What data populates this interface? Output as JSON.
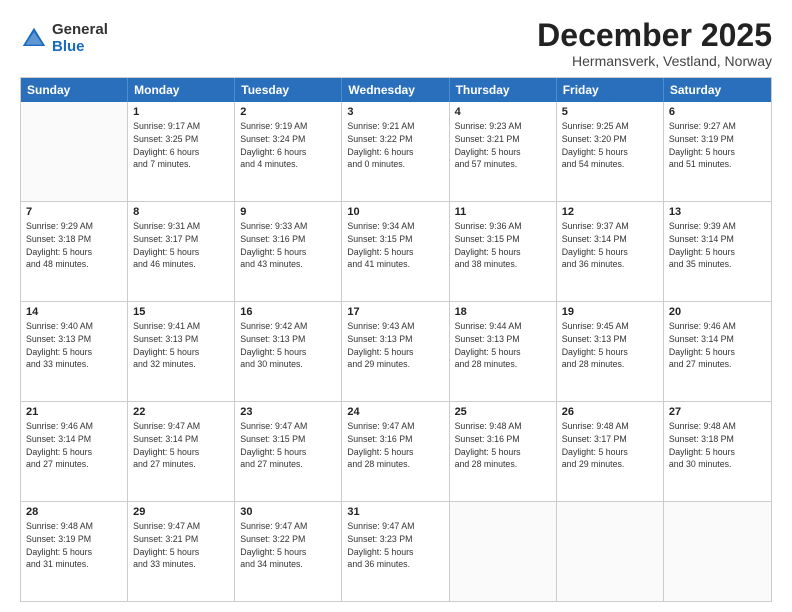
{
  "logo": {
    "general": "General",
    "blue": "Blue"
  },
  "title": "December 2025",
  "subtitle": "Hermansverk, Vestland, Norway",
  "days": [
    "Sunday",
    "Monday",
    "Tuesday",
    "Wednesday",
    "Thursday",
    "Friday",
    "Saturday"
  ],
  "weeks": [
    [
      {
        "day": "",
        "info": ""
      },
      {
        "day": "1",
        "info": "Sunrise: 9:17 AM\nSunset: 3:25 PM\nDaylight: 6 hours\nand 7 minutes."
      },
      {
        "day": "2",
        "info": "Sunrise: 9:19 AM\nSunset: 3:24 PM\nDaylight: 6 hours\nand 4 minutes."
      },
      {
        "day": "3",
        "info": "Sunrise: 9:21 AM\nSunset: 3:22 PM\nDaylight: 6 hours\nand 0 minutes."
      },
      {
        "day": "4",
        "info": "Sunrise: 9:23 AM\nSunset: 3:21 PM\nDaylight: 5 hours\nand 57 minutes."
      },
      {
        "day": "5",
        "info": "Sunrise: 9:25 AM\nSunset: 3:20 PM\nDaylight: 5 hours\nand 54 minutes."
      },
      {
        "day": "6",
        "info": "Sunrise: 9:27 AM\nSunset: 3:19 PM\nDaylight: 5 hours\nand 51 minutes."
      }
    ],
    [
      {
        "day": "7",
        "info": "Sunrise: 9:29 AM\nSunset: 3:18 PM\nDaylight: 5 hours\nand 48 minutes."
      },
      {
        "day": "8",
        "info": "Sunrise: 9:31 AM\nSunset: 3:17 PM\nDaylight: 5 hours\nand 46 minutes."
      },
      {
        "day": "9",
        "info": "Sunrise: 9:33 AM\nSunset: 3:16 PM\nDaylight: 5 hours\nand 43 minutes."
      },
      {
        "day": "10",
        "info": "Sunrise: 9:34 AM\nSunset: 3:15 PM\nDaylight: 5 hours\nand 41 minutes."
      },
      {
        "day": "11",
        "info": "Sunrise: 9:36 AM\nSunset: 3:15 PM\nDaylight: 5 hours\nand 38 minutes."
      },
      {
        "day": "12",
        "info": "Sunrise: 9:37 AM\nSunset: 3:14 PM\nDaylight: 5 hours\nand 36 minutes."
      },
      {
        "day": "13",
        "info": "Sunrise: 9:39 AM\nSunset: 3:14 PM\nDaylight: 5 hours\nand 35 minutes."
      }
    ],
    [
      {
        "day": "14",
        "info": "Sunrise: 9:40 AM\nSunset: 3:13 PM\nDaylight: 5 hours\nand 33 minutes."
      },
      {
        "day": "15",
        "info": "Sunrise: 9:41 AM\nSunset: 3:13 PM\nDaylight: 5 hours\nand 32 minutes."
      },
      {
        "day": "16",
        "info": "Sunrise: 9:42 AM\nSunset: 3:13 PM\nDaylight: 5 hours\nand 30 minutes."
      },
      {
        "day": "17",
        "info": "Sunrise: 9:43 AM\nSunset: 3:13 PM\nDaylight: 5 hours\nand 29 minutes."
      },
      {
        "day": "18",
        "info": "Sunrise: 9:44 AM\nSunset: 3:13 PM\nDaylight: 5 hours\nand 28 minutes."
      },
      {
        "day": "19",
        "info": "Sunrise: 9:45 AM\nSunset: 3:13 PM\nDaylight: 5 hours\nand 28 minutes."
      },
      {
        "day": "20",
        "info": "Sunrise: 9:46 AM\nSunset: 3:14 PM\nDaylight: 5 hours\nand 27 minutes."
      }
    ],
    [
      {
        "day": "21",
        "info": "Sunrise: 9:46 AM\nSunset: 3:14 PM\nDaylight: 5 hours\nand 27 minutes."
      },
      {
        "day": "22",
        "info": "Sunrise: 9:47 AM\nSunset: 3:14 PM\nDaylight: 5 hours\nand 27 minutes."
      },
      {
        "day": "23",
        "info": "Sunrise: 9:47 AM\nSunset: 3:15 PM\nDaylight: 5 hours\nand 27 minutes."
      },
      {
        "day": "24",
        "info": "Sunrise: 9:47 AM\nSunset: 3:16 PM\nDaylight: 5 hours\nand 28 minutes."
      },
      {
        "day": "25",
        "info": "Sunrise: 9:48 AM\nSunset: 3:16 PM\nDaylight: 5 hours\nand 28 minutes."
      },
      {
        "day": "26",
        "info": "Sunrise: 9:48 AM\nSunset: 3:17 PM\nDaylight: 5 hours\nand 29 minutes."
      },
      {
        "day": "27",
        "info": "Sunrise: 9:48 AM\nSunset: 3:18 PM\nDaylight: 5 hours\nand 30 minutes."
      }
    ],
    [
      {
        "day": "28",
        "info": "Sunrise: 9:48 AM\nSunset: 3:19 PM\nDaylight: 5 hours\nand 31 minutes."
      },
      {
        "day": "29",
        "info": "Sunrise: 9:47 AM\nSunset: 3:21 PM\nDaylight: 5 hours\nand 33 minutes."
      },
      {
        "day": "30",
        "info": "Sunrise: 9:47 AM\nSunset: 3:22 PM\nDaylight: 5 hours\nand 34 minutes."
      },
      {
        "day": "31",
        "info": "Sunrise: 9:47 AM\nSunset: 3:23 PM\nDaylight: 5 hours\nand 36 minutes."
      },
      {
        "day": "",
        "info": ""
      },
      {
        "day": "",
        "info": ""
      },
      {
        "day": "",
        "info": ""
      }
    ]
  ]
}
